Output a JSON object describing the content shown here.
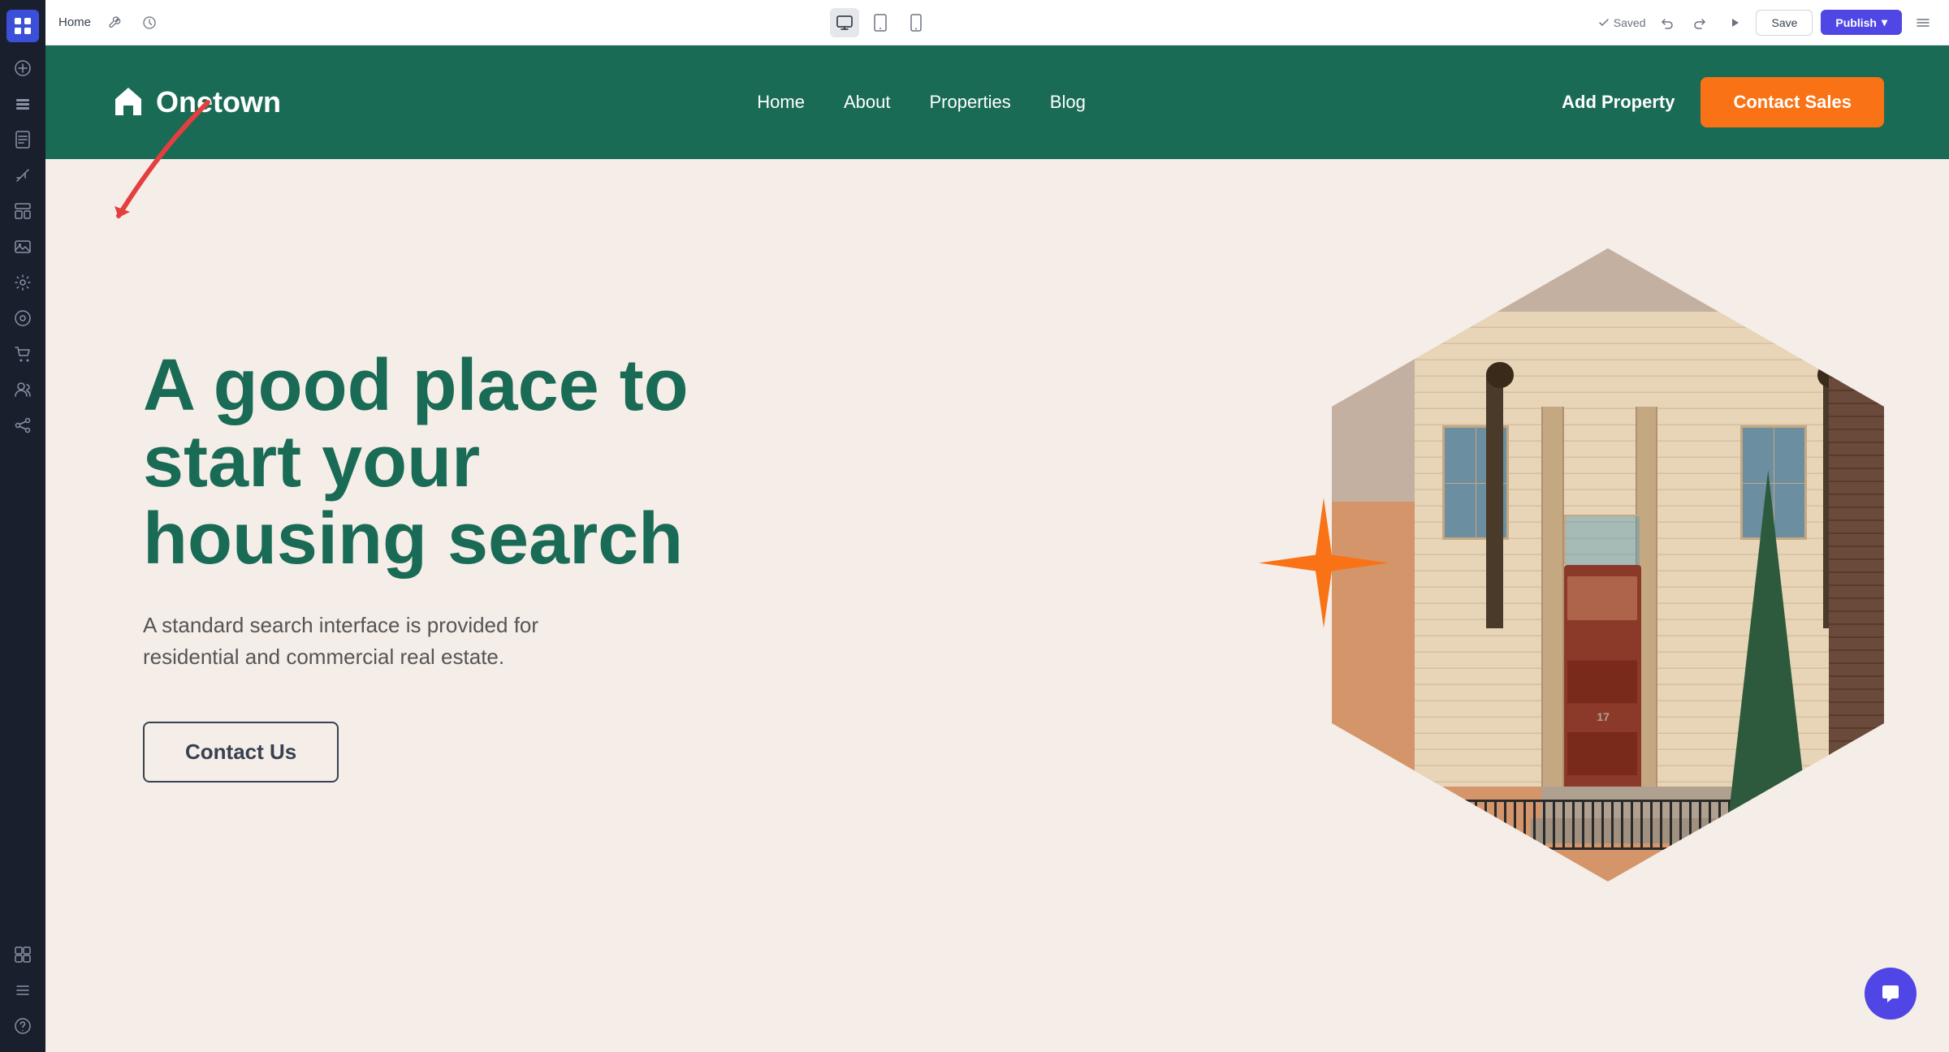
{
  "sidebar": {
    "icons": [
      {
        "name": "apps-icon",
        "symbol": "⊞",
        "active": true,
        "brand": true
      },
      {
        "name": "add-icon",
        "symbol": "+",
        "active": false
      },
      {
        "name": "layers-icon",
        "symbol": "▤",
        "active": false
      },
      {
        "name": "page-icon",
        "symbol": "⬜",
        "active": false
      },
      {
        "name": "templates-icon",
        "symbol": "✦",
        "active": false
      },
      {
        "name": "sections-icon",
        "symbol": "⊟",
        "active": false
      },
      {
        "name": "media-icon",
        "symbol": "🖼",
        "active": false
      },
      {
        "name": "settings-icon",
        "symbol": "⚙",
        "active": false
      },
      {
        "name": "blog-icon",
        "symbol": "◌",
        "active": false
      },
      {
        "name": "ecommerce-icon",
        "symbol": "☰",
        "active": false
      },
      {
        "name": "members-icon",
        "symbol": "👥",
        "active": false
      },
      {
        "name": "integrations-icon",
        "symbol": "✱",
        "active": false
      }
    ],
    "bottom_icons": [
      {
        "name": "shortcuts-icon",
        "symbol": "⌘",
        "active": false
      },
      {
        "name": "pages-icon",
        "symbol": "☰",
        "active": false
      },
      {
        "name": "history-icon",
        "symbol": "↺",
        "active": false
      }
    ]
  },
  "topbar": {
    "title": "Home",
    "wrench_icon": "🔧",
    "history_icon": "🕐",
    "devices": [
      {
        "name": "desktop-icon",
        "symbol": "🖥",
        "active": true
      },
      {
        "name": "tablet-icon",
        "symbol": "⬜",
        "active": false
      },
      {
        "name": "mobile-icon",
        "symbol": "📱",
        "active": false
      }
    ],
    "saved_label": "Saved",
    "undo_icon": "↩",
    "redo_icon": "↪",
    "play_icon": "▶",
    "save_label": "Save",
    "publish_label": "Publish",
    "publish_arrow": "▾",
    "menu_icon": "☰"
  },
  "nav": {
    "logo_icon": "🏠",
    "logo_text": "Onetown",
    "links": [
      {
        "label": "Home",
        "name": "nav-home"
      },
      {
        "label": "About",
        "name": "nav-about"
      },
      {
        "label": "Properties",
        "name": "nav-properties"
      },
      {
        "label": "Blog",
        "name": "nav-blog"
      }
    ],
    "add_property_label": "Add Property",
    "contact_btn_label": "Contact Sales"
  },
  "hero": {
    "title": "A good place to start your housing search",
    "subtitle": "A standard search interface is provided for residential and commercial real estate.",
    "cta_label": "Contact Us"
  },
  "colors": {
    "green": "#1a6b55",
    "orange": "#f97316",
    "bg": "#f5ede8",
    "purple": "#4f46e5"
  },
  "chat_bubble_icon": "💬"
}
